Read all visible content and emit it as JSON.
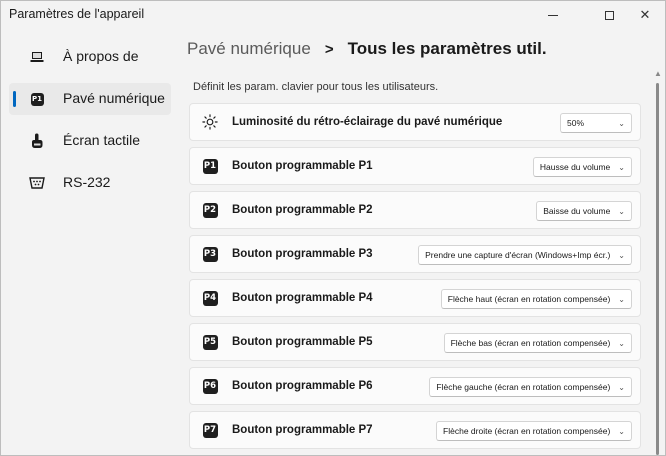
{
  "window": {
    "title": "Paramètres de l'appareil",
    "controls": {
      "minimize": "—",
      "maximize": "☐",
      "close": "✕"
    }
  },
  "sidebar": {
    "items": [
      {
        "label": "À propos de",
        "icon": "laptop-icon",
        "active": false
      },
      {
        "label": "Pavé numérique",
        "icon": "keypad-p1-icon",
        "active": true
      },
      {
        "label": "Écran tactile",
        "icon": "touch-icon",
        "active": false
      },
      {
        "label": "RS-232",
        "icon": "serial-port-icon",
        "active": false
      }
    ]
  },
  "header": {
    "parent": "Pavé numérique",
    "separator": ">",
    "current": "Tous les paramètres util."
  },
  "description": "Définit les param. clavier pour tous les utilisateurs.",
  "settings": [
    {
      "icon": "brightness-icon",
      "badge": "",
      "label": "Luminosité du rétro-éclairage du pavé numérique",
      "value": "50%"
    },
    {
      "icon": "p1-icon",
      "badge": "P1",
      "label": "Bouton programmable P1",
      "value": "Hausse du volume"
    },
    {
      "icon": "p2-icon",
      "badge": "P2",
      "label": "Bouton programmable P2",
      "value": "Baisse du volume"
    },
    {
      "icon": "p3-icon",
      "badge": "P3",
      "label": "Bouton programmable P3",
      "value": "Prendre une capture d'écran (Windows+Imp écr.)"
    },
    {
      "icon": "p4-icon",
      "badge": "P4",
      "label": "Bouton programmable P4",
      "value": "Flèche haut (écran en rotation compensée)"
    },
    {
      "icon": "p5-icon",
      "badge": "P5",
      "label": "Bouton programmable P5",
      "value": "Flèche bas (écran en rotation compensée)"
    },
    {
      "icon": "p6-icon",
      "badge": "P6",
      "label": "Bouton programmable P6",
      "value": "Flèche gauche (écran en rotation compensée)"
    },
    {
      "icon": "p7-icon",
      "badge": "P7",
      "label": "Bouton programmable P7",
      "value": "Flèche droite (écran en rotation compensée)"
    }
  ],
  "colors": {
    "accent": "#0067c0",
    "badge": "#1f1f1f"
  }
}
